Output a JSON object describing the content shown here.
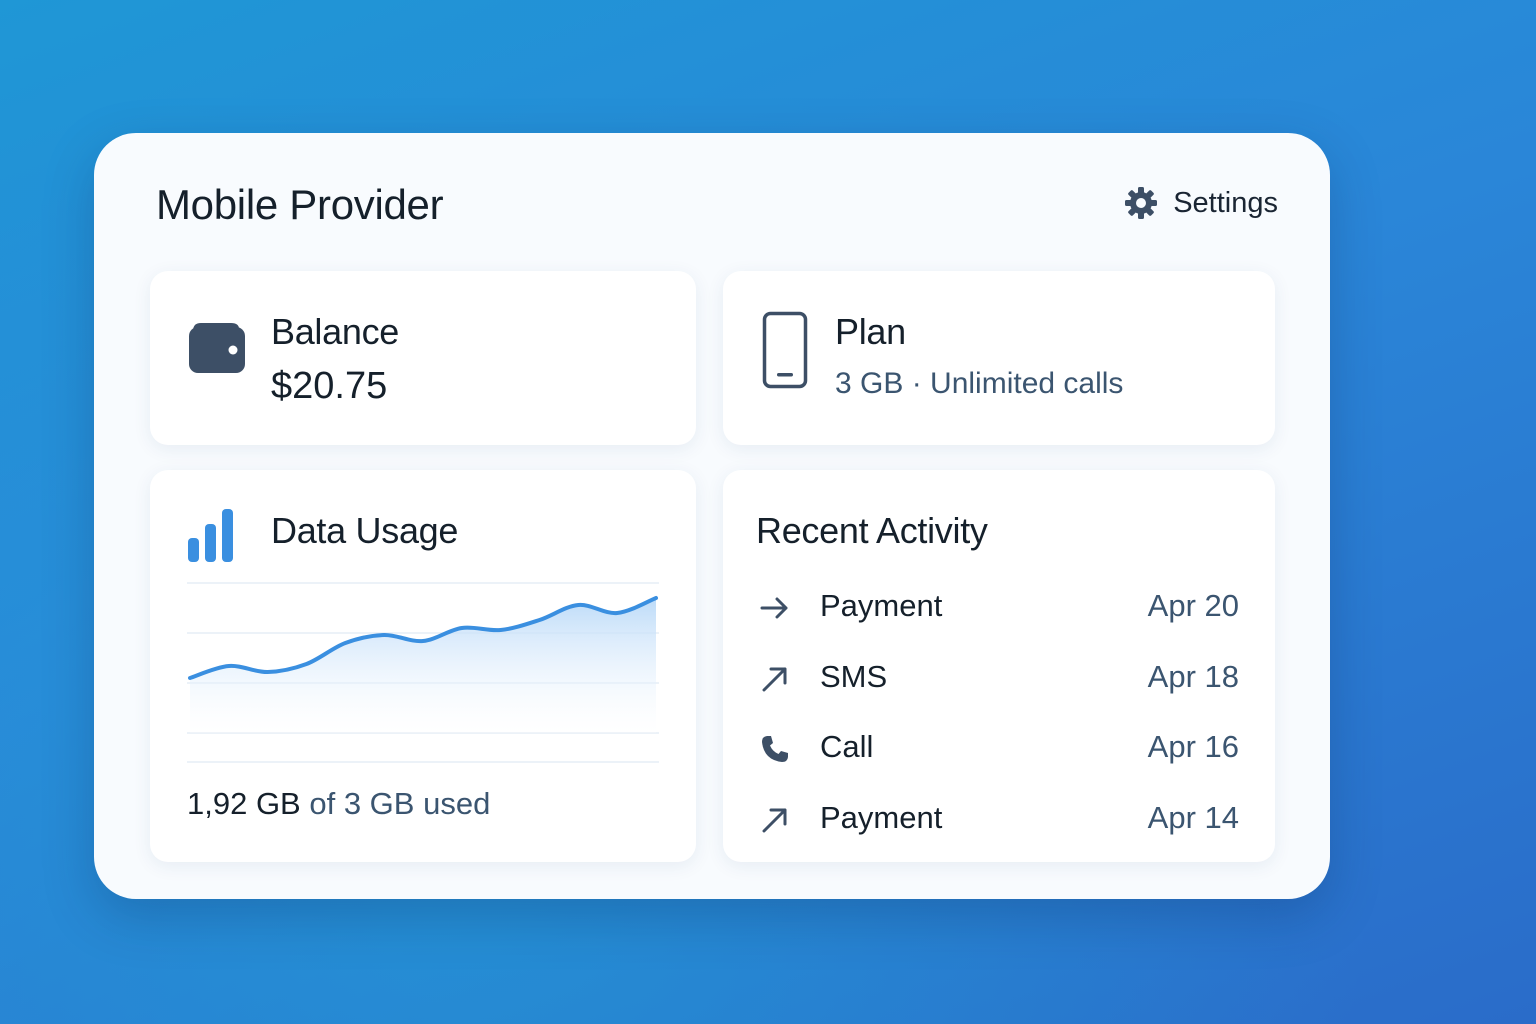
{
  "app": {
    "title": "Mobile Provider",
    "settings_label": "Settings"
  },
  "balance": {
    "heading": "Balance",
    "value": "$20.75",
    "icon": "wallet-icon"
  },
  "plan": {
    "heading": "Plan",
    "details": "3 GB · Unlimited calls",
    "icon": "phone-icon"
  },
  "data_usage": {
    "heading": "Data Usage",
    "icon": "signal-bars-icon",
    "used_amount": "1,92 GB",
    "used_suffix": " of 3 GB used",
    "trend": [
      0.2,
      0.32,
      0.26,
      0.34,
      0.55,
      0.63,
      0.57,
      0.7,
      0.68,
      0.78,
      0.93,
      0.85,
      1.0
    ],
    "line_color": "#3a8fe0",
    "fill_color": "#cfe5fb"
  },
  "recent_activity": {
    "heading": "Recent Activity",
    "items": [
      {
        "label": "Payment",
        "date": "Apr 20",
        "icon": "arrow-right-icon"
      },
      {
        "label": "SMS",
        "date": "Apr 18",
        "icon": "arrow-up-right-icon"
      },
      {
        "label": "Call",
        "date": "Apr 16",
        "icon": "phone-call-icon"
      },
      {
        "label": "Payment",
        "date": "Apr 14",
        "icon": "arrow-up-right-icon"
      }
    ]
  },
  "colors": {
    "background_start": "#1f97d6",
    "background_end": "#2a6cc9",
    "card": "#f8fbfe",
    "icon_dark": "#3d4f66",
    "accent": "#3a8fe0"
  }
}
